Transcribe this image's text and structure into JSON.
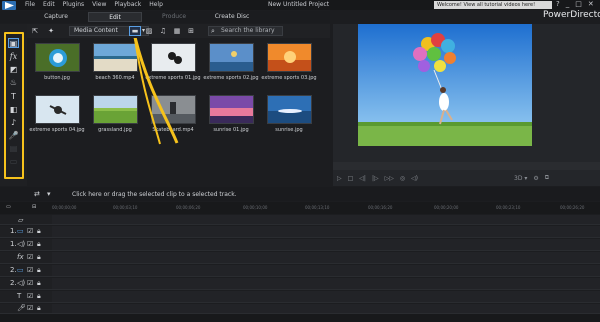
{
  "menu": [
    "File",
    "Edit",
    "Plugins",
    "View",
    "Playback",
    "Help"
  ],
  "project_title": "New Untitled Project",
  "notification": "Welcome! View all tutorial videos here!",
  "window_controls": [
    "?",
    "_",
    "□",
    "✕"
  ],
  "brand": "PowerDirector",
  "mode_tabs": [
    "Capture",
    "Edit",
    "Produce",
    "Create Disc"
  ],
  "library": {
    "dropdown": "Media Content",
    "search_placeholder": "Search the library",
    "items": [
      {
        "label": "button.jpg"
      },
      {
        "label": "beach 360.mp4"
      },
      {
        "label": "extreme sports 01.jpg"
      },
      {
        "label": "extreme sports 02.jpg"
      },
      {
        "label": "extreme sports 03.jpg"
      },
      {
        "label": "extreme sports 04.jpg"
      },
      {
        "label": "grassland.jpg"
      },
      {
        "label": "Skateboard.mp4"
      },
      {
        "label": "sunrise 01.jpg"
      },
      {
        "label": "sunrise.jpg"
      }
    ]
  },
  "timeline": {
    "hint": "Click here or drag the selected clip to a selected track.",
    "ruler": [
      "00;00;00;00",
      "00;00;03;10",
      "00;00;06;20",
      "00;00;10;00",
      "00;00;13;10",
      "00;00;16;20",
      "00;00;20;00",
      "00;00;23;10",
      "00;00;26;20",
      "00;00;30;00",
      "00;00;33;10",
      "00;00;36;20"
    ],
    "track_numbers": [
      "1.",
      "1.",
      "2.",
      "2."
    ]
  },
  "colors": {
    "accent": "#5aa0e6",
    "highlight": "#f6c21c"
  }
}
